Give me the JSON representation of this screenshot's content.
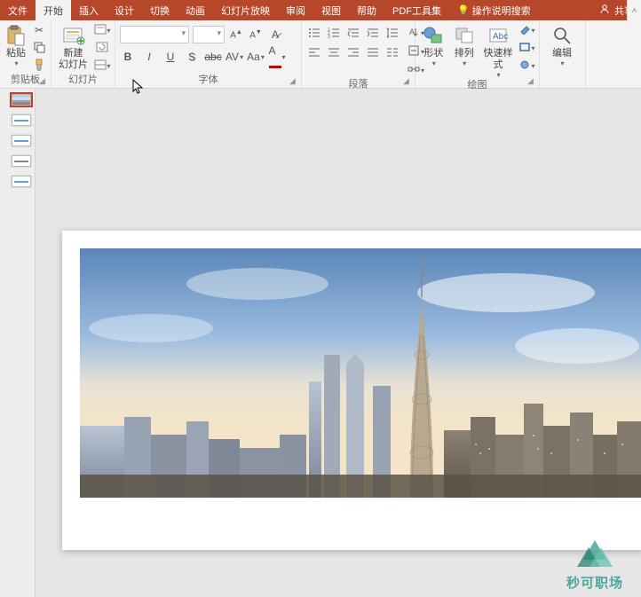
{
  "tabs": {
    "file": "文件",
    "home": "开始",
    "insert": "插入",
    "design": "设计",
    "transition": "切换",
    "animation": "动画",
    "slideshow": "幻灯片放映",
    "review": "审阅",
    "view": "视图",
    "help": "帮助",
    "pdf": "PDF工具集",
    "tellme": "操作说明搜索"
  },
  "share": "共享",
  "groups": {
    "clipboard": {
      "label": "剪贴板",
      "paste": "粘贴"
    },
    "slides": {
      "label": "幻灯片",
      "newslide": "新建\n幻灯片"
    },
    "font": {
      "label": "字体",
      "name": "",
      "size": ""
    },
    "paragraph": {
      "label": "段落"
    },
    "drawing": {
      "label": "绘图",
      "shapes": "形状",
      "arrange": "排列",
      "quickstyle": "快速样式"
    },
    "editing": {
      "label": "编辑",
      "edit": "编辑"
    }
  },
  "thumbs": {
    "count": 5,
    "selected": 1
  },
  "watermark": {
    "text": "秒可职场"
  }
}
